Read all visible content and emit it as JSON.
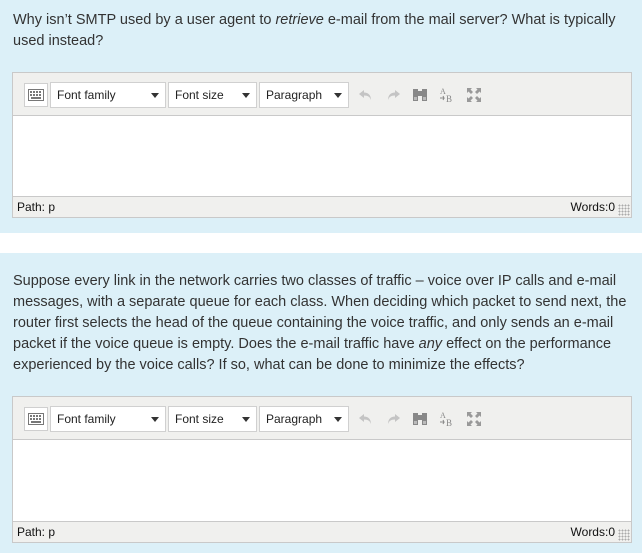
{
  "questions": [
    {
      "text_before": "Why isn’t SMTP used by a user agent to ",
      "text_emph": "retrieve",
      "text_after": " e-mail from the mail server?  What is typically used instead?",
      "editor": {
        "font_family": "Font family",
        "font_size": "Font size",
        "paragraph": "Paragraph",
        "path_label": "Path: p",
        "words_label": "Words:0"
      }
    },
    {
      "text_before": "Suppose every link in the network carries two classes of traffic – voice over IP calls and e-mail messages, with a separate queue for each class.  When deciding which packet to send next, the router first selects the head of the queue containing the voice traffic, and only sends an e-mail packet if the voice queue is empty.  Does the e-mail traffic have ",
      "text_emph": "any",
      "text_after": " effect on the performance experienced by the voice calls?  If so, what can be done to minimize the effects?",
      "editor": {
        "font_family": "Font family",
        "font_size": "Font size",
        "paragraph": "Paragraph",
        "path_label": "Path: p",
        "words_label": "Words:0"
      }
    }
  ],
  "icons": {
    "find_glyph": "▛▜",
    "spell_a": "A",
    "spell_b": "B"
  }
}
